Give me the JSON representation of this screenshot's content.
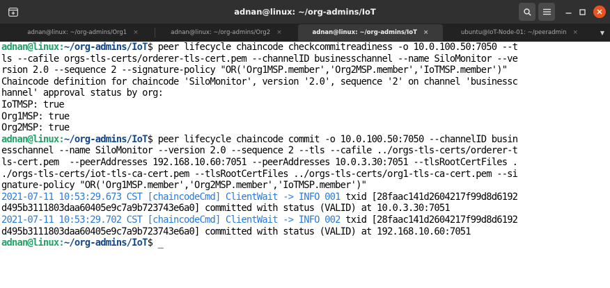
{
  "window": {
    "title": "adnan@linux: ~/org-admins/IoT",
    "buttons": {
      "new_tab_icon": "new-tab-icon",
      "search_icon": "search-icon",
      "menu_icon": "hamburger-menu-icon",
      "minimize_icon": "minimize-icon",
      "maximize_icon": "maximize-icon",
      "close_icon": "close-icon"
    }
  },
  "tabs": [
    {
      "label": "adnan@linux: ~/org-admins/Org1",
      "active": false
    },
    {
      "label": "adnan@linux: ~/org-admins/Org2",
      "active": false
    },
    {
      "label": "adnan@linux: ~/org-admins/IoT",
      "active": true
    },
    {
      "label": "ubuntu@IoT-Node-01: ~/peeradmin",
      "active": false
    }
  ],
  "tab_close_glyph": "×",
  "tab_dropdown_glyph": "▼",
  "colors": {
    "titlebar": "#303030",
    "tabstrip": "#222222",
    "prompt_user": "#26a269",
    "prompt_path": "#12488b",
    "log_info": "#2a7bde",
    "close_button": "#e95420"
  },
  "terminal": {
    "prompt": {
      "user_host": "adnan@linux:",
      "path": "~/org-admins/IoT",
      "symbol": "$ "
    },
    "lines": [
      {
        "prompt": true,
        "text": "peer lifecycle chaincode checkcommitreadiness -o 10.0.100.50:7050 --t"
      },
      {
        "text": "ls --cafile orgs-tls-certs/orderer-tls-cert.pem --channelID businesschannel --name SiloMonitor --ve"
      },
      {
        "text": "rsion 2.0 --sequence 2 --signature-policy \"OR('Org1MSP.member','Org2MSP.member','IoTMSP.member')\""
      },
      {
        "text": "Chaincode definition for chaincode 'SiloMonitor', version '2.0', sequence '2' on channel 'businessc"
      },
      {
        "text": "hannel' approval status by org:"
      },
      {
        "text": "IoTMSP: true"
      },
      {
        "text": "Org1MSP: true"
      },
      {
        "text": "Org2MSP: true"
      },
      {
        "prompt": true,
        "text": "peer lifecycle chaincode commit -o 10.0.100.50:7050 --channelID busin"
      },
      {
        "text": "esschannel --name SiloMonitor --version 2.0 --sequence 2 --tls --cafile ../orgs-tls-certs/orderer-t"
      },
      {
        "text": "ls-cert.pem  --peerAddresses 192.168.10.60:7051 --peerAddresses 10.0.3.30:7051 --tlsRootCertFiles ."
      },
      {
        "text": "./orgs-tls-certs/iot-tls-ca-cert.pem --tlsRootCertFiles ../orgs-tls-certs/org1-tls-ca-cert.pem --si"
      },
      {
        "text": "gnature-policy \"OR('Org1MSP.member','Org2MSP.member','IoTMSP.member')\""
      },
      {
        "log": "2021-07-11 10:53:29.673 CST [chaincodeCmd] ClientWait -> INFO 001",
        "text": " txid [28faac141d2604217f99d8d6192"
      },
      {
        "text": "d495b3111803daa60405e9c7a9b723743e6a0] committed with status (VALID) at 10.0.3.30:7051"
      },
      {
        "log": "2021-07-11 10:53:29.702 CST [chaincodeCmd] ClientWait -> INFO 002",
        "text": " txid [28faac141d2604217f99d8d6192"
      },
      {
        "text": "d495b3111803daa60405e9c7a9b723743e6a0] committed with status (VALID) at 192.168.10.60:7051"
      },
      {
        "prompt": true,
        "text": "",
        "cursor": "_"
      }
    ]
  }
}
